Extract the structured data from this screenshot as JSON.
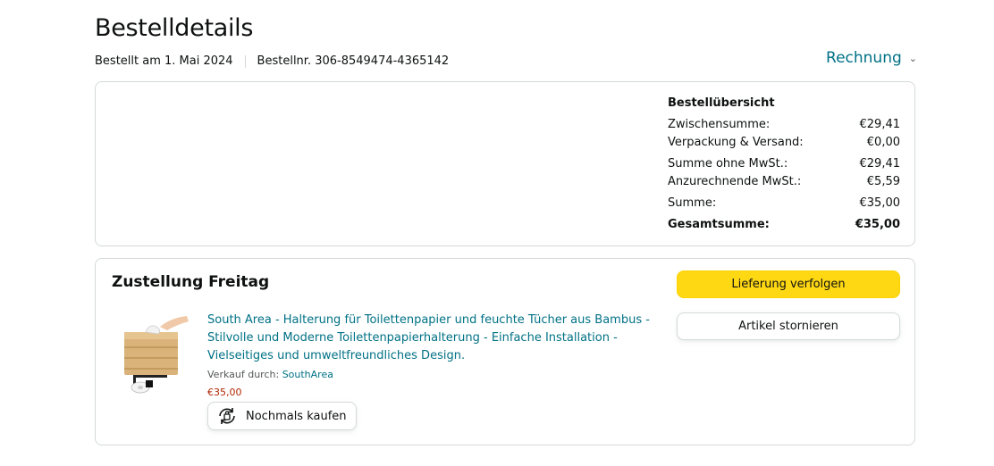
{
  "page": {
    "title": "Bestelldetails",
    "order_date": "Bestellt am 1. Mai 2024",
    "order_number": "Bestellnr. 306-8549474-4365142",
    "invoice_label": "Rechnung"
  },
  "summary": {
    "heading": "Bestellübersicht",
    "rows": [
      {
        "label": "Zwischensumme:",
        "value": "€29,41"
      },
      {
        "label": "Verpackung & Versand:",
        "value": "€0,00"
      },
      {
        "label": "Summe ohne MwSt.:",
        "value": "€29,41"
      },
      {
        "label": "Anzurechnende MwSt.:",
        "value": "€5,59"
      },
      {
        "label": "Summe:",
        "value": "€35,00"
      },
      {
        "label": "Gesamtsumme:",
        "value": "€35,00"
      }
    ]
  },
  "delivery": {
    "title": "Zustellung Freitag",
    "track_button": "Lieferung verfolgen",
    "cancel_button": "Artikel stornieren",
    "product": {
      "title": "South Area - Halterung für Toilettenpapier und feuchte Tücher aus Bambus - Stilvolle und Moderne Toilettenpapierhalterung - Einfache Installation - Vielseitiges und umweltfreundliches Design.",
      "seller_prefix": "Verkauf durch:",
      "seller_name": "SouthArea",
      "price": "€35,00",
      "rebuy_label": "Nochmals kaufen"
    }
  },
  "colors": {
    "link": "#007185",
    "primary_button": "#ffd814",
    "price": "#b12704"
  },
  "icons": {
    "invoice_dropdown": "chevron-down-icon",
    "rebuy": "rebuy-icon"
  }
}
